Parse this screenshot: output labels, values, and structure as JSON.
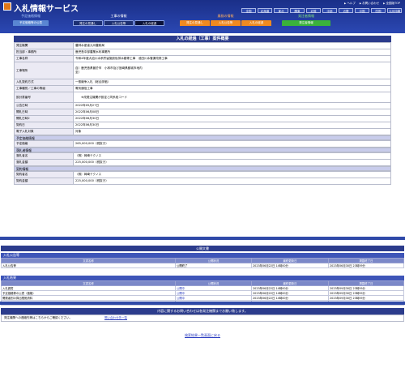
{
  "header": {
    "title": "入札情報サービス",
    "links": [
      "ヘルプ",
      "お問い合わせ",
      "全国版TOP"
    ],
    "regions": [
      "全国",
      "北海道",
      "東北",
      "関東",
      "北陸",
      "中部",
      "近畿",
      "中国",
      "四国",
      "九州沖縄"
    ]
  },
  "categories": [
    {
      "title": "予定価格情報",
      "buttons": [
        "予定価格等の公表"
      ]
    },
    {
      "title": "工事の情報",
      "buttons": [
        "発注の見通し",
        "入札公告等",
        "入札の経過"
      ]
    },
    {
      "title": "業務の情報",
      "buttons": [
        "発注の見通し",
        "入札公告等",
        "入札の経過"
      ]
    },
    {
      "title": "発注者情報",
      "buttons": [
        "発注者情報"
      ]
    }
  ],
  "detail": {
    "heading": "入札の経過（工事）案件概要",
    "rows": [
      {
        "key": "発注機関",
        "value": "農林水産省九州農政局"
      },
      {
        "key": "担当部・事務所",
        "value": "鹿児島中部農業水利事業所"
      },
      {
        "key": "工事名称",
        "value": "令和4年度大迫川水系貯留施設仮排水路等工事　池田川水管渠改修工事"
      },
      {
        "key": "工事場所",
        "value": "自）鹿児島県曽於市　小林市及び宮崎県都城市地内\n至）"
      },
      {
        "key": "入札契約方式",
        "value": "一般競争入札（総合評価）"
      },
      {
        "key": "工事種別／工事の等級",
        "value": "電気通信工事"
      },
      {
        "key": "設計書番号",
        "value": "　　※改発注機関が設定と同系段コード"
      },
      {
        "key": "公告日時",
        "value": "2022年05月27日"
      },
      {
        "key": "開札日時",
        "value": "2022年06月08日"
      },
      {
        "key": "開札日時2",
        "value": "2022年06月30日"
      },
      {
        "key": "契約日",
        "value": "2022年06月30日"
      },
      {
        "key": "電子入札対象",
        "value": "対象"
      }
    ],
    "section_price": "予定価格情報",
    "price_rows": [
      {
        "key": "予定価格",
        "value": "265,000,000（税抜き）"
      }
    ],
    "section_winner": "落札者情報",
    "winner_rows": [
      {
        "key": "落札者名",
        "value": "（株）岡崎テクノス"
      },
      {
        "key": "落札金額",
        "value": "225,000,000（税抜き）"
      }
    ],
    "section_contract": "契約情報",
    "contract_rows": [
      {
        "key": "契約者名",
        "value": "（株）岡崎テクノス"
      },
      {
        "key": "契約金額",
        "value": "225,000,000（税抜き）"
      }
    ]
  },
  "docs": {
    "heading": "公開文書",
    "group1": "入札公告等",
    "columns": [
      "文書名称",
      "公開状況",
      "最終更新日",
      "掲載終了日"
    ],
    "rows1": [
      [
        "入札公告等",
        "公開終了",
        "2023年06月22日 14時00分",
        "2023年06月30日 23時59分"
      ]
    ],
    "group2": "入札結果",
    "rows2": [
      [
        "入札調書",
        "公開中",
        "2023年06月22日 14時00分",
        "2023年09月30日 23時59分"
      ],
      [
        "予定価格等の公表（価格）",
        "公開中",
        "2023年06月22日 14時00分",
        "2023年09月30日 23時59分"
      ],
      [
        "開発者別の算出根拠資料",
        "公開中",
        "2023年06月22日 14時00分",
        "2023年09月30日 23時59分"
      ],
      [
        "工事等の経緯",
        "公開中",
        "2023年06月22日 14時00分",
        "2023年09月30日 23時59分"
      ]
    ]
  },
  "contact": {
    "heading": "内容に関するお問い合わせは各発注機関までお願い致します。",
    "text": "発注機関への連絡先等はこちらからご確認ください。",
    "link": "問い合わせ先一覧"
  },
  "back_link": "検索結果一覧画面に戻る"
}
